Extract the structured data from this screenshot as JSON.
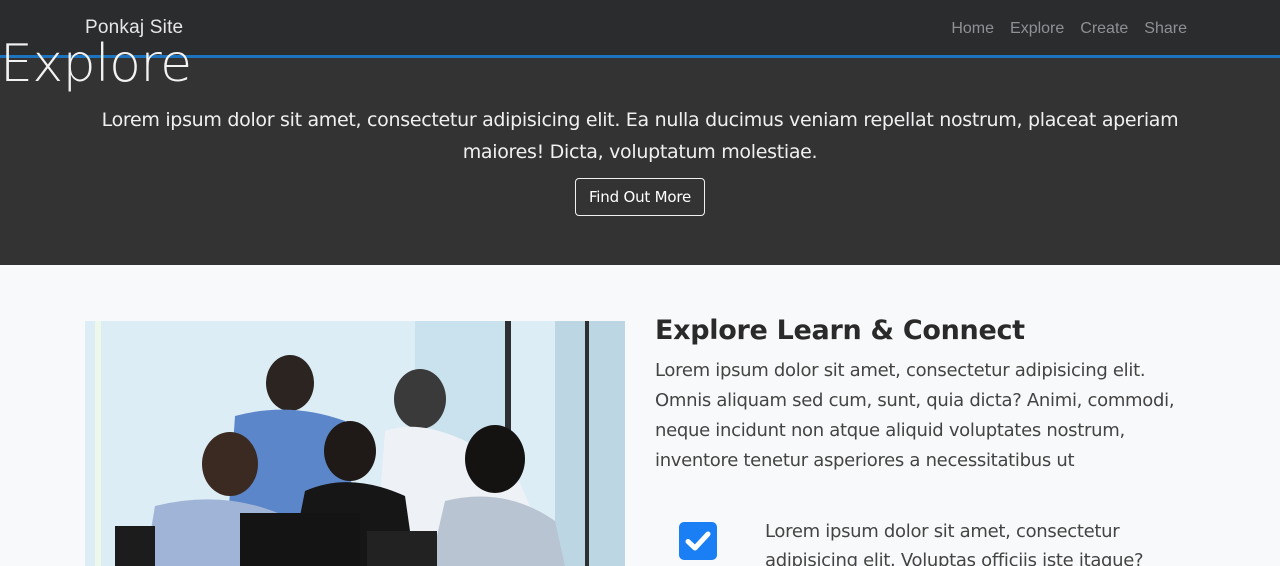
{
  "navbar": {
    "brand": "Ponkaj Site",
    "links": [
      "Home",
      "Explore",
      "Create",
      "Share"
    ]
  },
  "hero": {
    "title": "Explore",
    "text": "Lorem ipsum dolor sit amet, consectetur adipisicing elit. Ea nulla ducimus veniam repellat nostrum, placeat aperiam maiores! Dicta, voluptatum molestiae.",
    "button_label": "Find Out More"
  },
  "section": {
    "heading": "Explore Learn & Connect",
    "text": "Lorem ipsum dolor sit amet, consectetur adipisicing elit. Omnis aliquam sed cum, sunt, quia dicta? Animi, commodi, neque incidunt non atque aliquid voluptates nostrum, inventore tenetur asperiores a necessitatibus ut",
    "feature": {
      "icon": "check-square-icon",
      "text": "Lorem ipsum dolor sit amet, consectetur adipisicing elit. Voluptas officiis iste itaque?"
    }
  },
  "colors": {
    "navbar_bg": "#2b2c2e",
    "hero_bg": "#333334",
    "accent_line": "#1e73be",
    "check_blue": "#1a7ff5",
    "section_bg": "#f8f9fa"
  }
}
